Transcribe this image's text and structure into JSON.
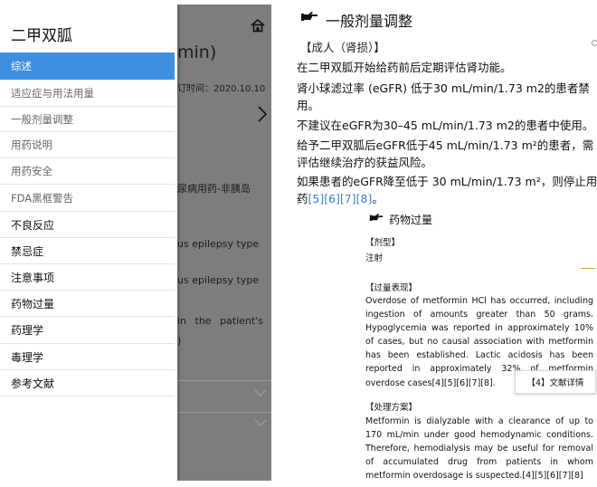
{
  "left": {
    "drawer_title": "二甲双胍",
    "menu": [
      {
        "label": "综述",
        "active": true
      },
      {
        "label": "适应症与用法用量"
      },
      {
        "label": "一般剂量调整"
      },
      {
        "label": "用药说明"
      },
      {
        "label": "用药安全"
      },
      {
        "label": "FDA黑框警告"
      },
      {
        "label": "不良反应"
      },
      {
        "label": "禁忌症"
      },
      {
        "label": "注意事项"
      },
      {
        "label": "药物过量"
      },
      {
        "label": "药理学"
      },
      {
        "label": "毒理学"
      },
      {
        "label": "参考文献"
      }
    ],
    "background": {
      "title_fragment": "min)",
      "date_fragment": "订时间：2020.10.10",
      "line1": "尿病用药-非胰岛",
      "line2": "us epilepsy type",
      "line3": "us epilepsy type",
      "line4": "in the patient's",
      "line5": ")"
    }
  },
  "right": {
    "section_title": "一般剂量调整",
    "adult_label": "【成人（肾损）】",
    "para_lines": [
      "在二甲双胍开始给药前后定期评估肾功能。",
      "肾小球滤过率 (eGFR) 低于30 mL/min/1.73 m2的患者禁",
      "用。",
      "不建议在eGFR为30–45 mL/min/1.73 m2的患者中使用。",
      "给予二甲双胍后eGFR低于45 mL/min/1.73 m²的患者，需",
      "评估继续治疗的获益风险。",
      "如果患者的eGFR降至低于 30 mL/min/1.73 m²，则停止用"
    ],
    "last_line_prefix": "药",
    "last_line_refs": "[5][6][7][8]",
    "last_line_suffix": "。",
    "overdose_title": "药物过量",
    "dosage_form_label": "【剂型】",
    "dosage_form_value": "注射",
    "manifest_label": "【过量表现】",
    "manifest_text": "Overdose of metformin HCl has occurred, including ingestion of amounts greater than 50 grams. Hypoglycemia was reported in approximately 10% of cases, but no causal association with metformin has been established. Lactic acidosis has been reported in approximately 32% of metformin overdose cases[4][5][6][7][8].",
    "ref_button_label": "【4】文献详情",
    "treatment_label": "【处理方案】",
    "treatment_text": "Metformin is dialyzable with a clearance of up to 170 mL/min under good hemodynamic conditions. Therefore, hemodialysis may be useful for removal of accumulated drug from patients in whom metformin overdosage is suspected.[4][5][6][7][8]"
  },
  "colors": {
    "active_menu": "#3e8fe0",
    "ref_link": "#3a7fd0",
    "overlay": "#7d7d7d"
  }
}
